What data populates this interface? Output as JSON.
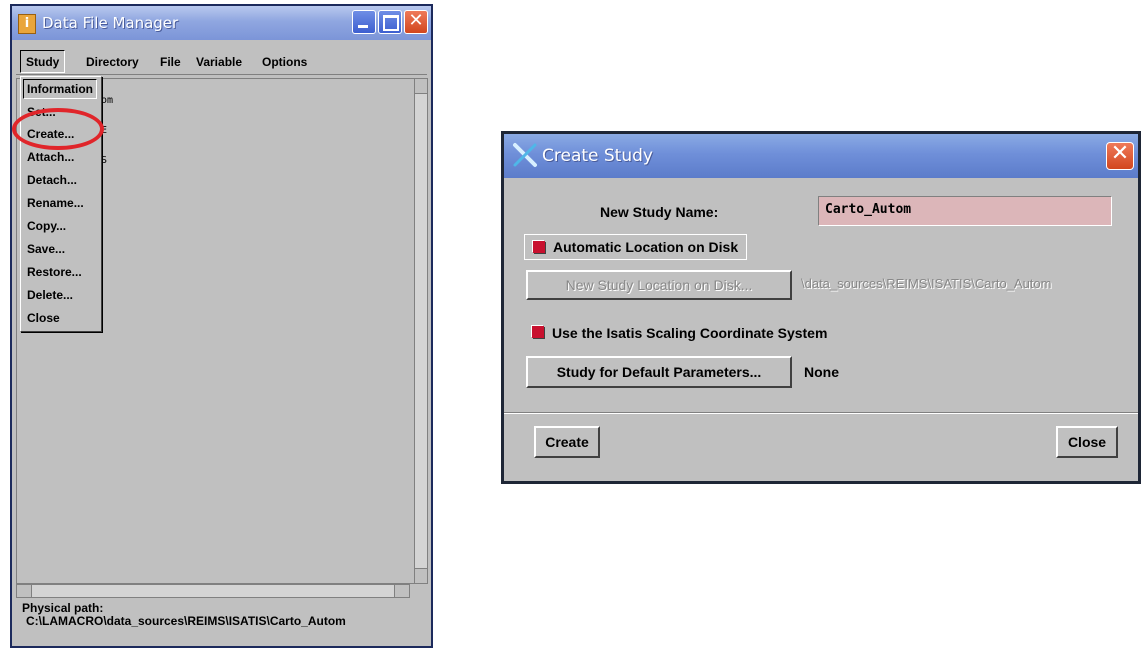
{
  "dfm": {
    "title": "Data File Manager",
    "app_icon": "i",
    "menu": [
      "Study",
      "Directory",
      "File",
      "Variable",
      "Options"
    ],
    "list_fragments": [
      "om",
      "E",
      "S"
    ],
    "dropdown": [
      "Information",
      "Set...",
      "Create...",
      "Attach...",
      "Detach...",
      "Rename...",
      "Copy...",
      "Save...",
      "Restore...",
      "Delete...",
      "Close"
    ],
    "physical_label": "Physical path:",
    "physical_path": "C:\\LAMACRO\\data_sources\\REIMS\\ISATIS\\Carto_Autom"
  },
  "cs": {
    "title": "Create Study",
    "name_label": "New Study Name:",
    "name_value": "Carto_Autom",
    "auto_location_label": "Automatic Location on Disk",
    "auto_location_checked": true,
    "location_button": "New Study Location on Disk...",
    "location_value": "\\data_sources\\REIMS\\ISATIS\\Carto_Autom",
    "scaling_label": "Use the Isatis Scaling Coordinate System",
    "scaling_checked": true,
    "default_params_button": "Study for Default Parameters...",
    "default_params_value": "None",
    "create_button": "Create",
    "close_button": "Close"
  },
  "colors": {
    "checkbox_red": "#c8102e",
    "name_field_bg": "#dcb6b9",
    "highlight_circle": "#e0252a"
  }
}
